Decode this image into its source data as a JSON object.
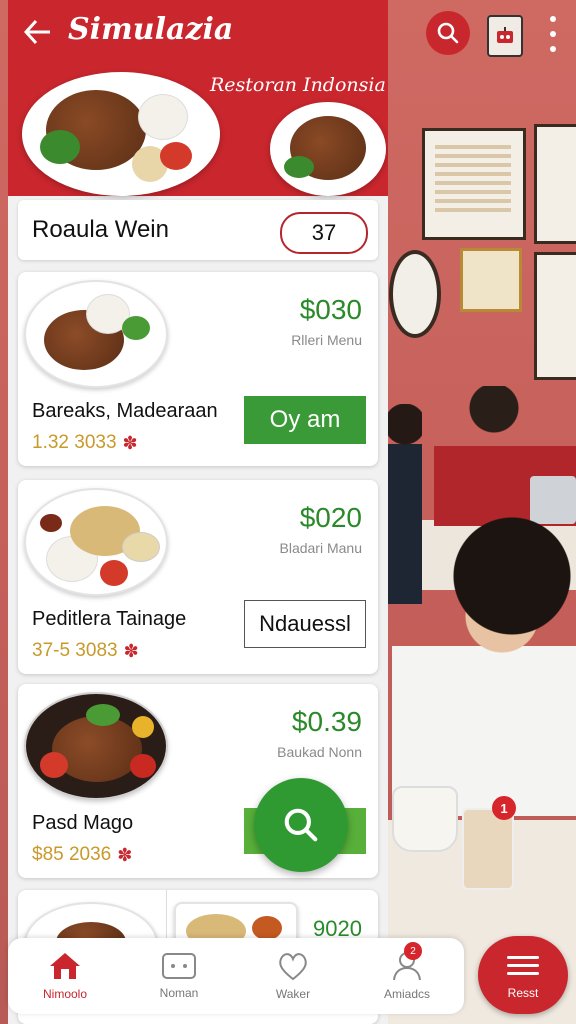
{
  "app": {
    "title": "Simulazia",
    "restaurant_name": "Restoran Indonsia"
  },
  "search": {
    "value": "Roaula Wein",
    "count": "37"
  },
  "menu_items": [
    {
      "name": "Bareaks, Madearaan",
      "price": "$030",
      "sub": "Rlleri Menu",
      "meta": "1.32 3033",
      "action": "Oy am"
    },
    {
      "name": "Peditlera Tainage",
      "price": "$020",
      "sub": "Bladari Manu",
      "meta": "37-5 3083",
      "action": "Ndauessl"
    },
    {
      "name": "Pasd Mago",
      "price": "$0.39",
      "sub": "Baukad Nonn",
      "meta": "$85 2036"
    },
    {
      "name": "",
      "price": "9020"
    }
  ],
  "bottom_nav": [
    {
      "label": "Nimoolo",
      "icon": "home-icon",
      "active": true
    },
    {
      "label": "Noman",
      "icon": "chat-icon",
      "active": false
    },
    {
      "label": "Waker",
      "icon": "heart-icon",
      "active": false
    },
    {
      "label": "Amiadcs",
      "icon": "user-icon",
      "active": false,
      "badge": "2"
    }
  ],
  "reset": {
    "label": "Resst"
  },
  "background": {
    "cup_badge": "1"
  },
  "colors": {
    "brand_red": "#c9262d",
    "accent_green": "#3a9a37",
    "price_green": "#2a8a2a",
    "meta_gold": "#c89a2a"
  }
}
